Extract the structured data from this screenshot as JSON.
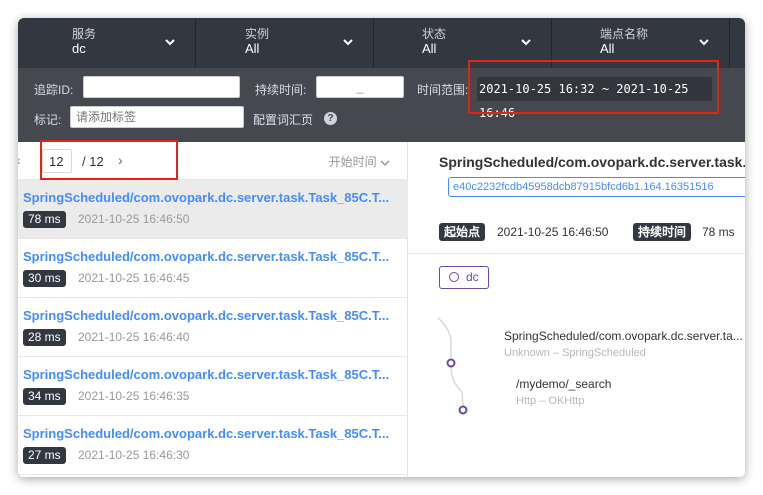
{
  "filters": [
    {
      "label": "服务",
      "value": "dc"
    },
    {
      "label": "实例",
      "value": "All"
    },
    {
      "label": "状态",
      "value": "All"
    },
    {
      "label": "端点名称",
      "value": "All"
    }
  ],
  "search": {
    "trace_id_label": "追踪ID:",
    "trace_id_value": "",
    "duration_label": "持续时间:",
    "duration_placeholder": "_",
    "time_range_label": "时间范围:",
    "time_range_value": "2021-10-25 16:32 ~ 2021-10-25 16:46",
    "tags_label": "标记:",
    "tags_placeholder": "请添加标签",
    "config_link": "配置词汇页",
    "help_symbol": "?"
  },
  "pager": {
    "prev_symbol": "‹",
    "current_page": "12",
    "total": "/ 12",
    "next_symbol": "›",
    "sort_label": "开始时间"
  },
  "traces": [
    {
      "name": "SpringScheduled/com.ovopark.dc.server.task.Task_85C.T...",
      "duration": "78 ms",
      "time": "2021-10-25 16:46:50"
    },
    {
      "name": "SpringScheduled/com.ovopark.dc.server.task.Task_85C.T...",
      "duration": "30 ms",
      "time": "2021-10-25 16:46:45"
    },
    {
      "name": "SpringScheduled/com.ovopark.dc.server.task.Task_85C.T...",
      "duration": "28 ms",
      "time": "2021-10-25 16:46:40"
    },
    {
      "name": "SpringScheduled/com.ovopark.dc.server.task.Task_85C.T...",
      "duration": "34 ms",
      "time": "2021-10-25 16:46:35"
    },
    {
      "name": "SpringScheduled/com.ovopark.dc.server.task.Task_85C.T...",
      "duration": "27 ms",
      "time": "2021-10-25 16:46:30"
    }
  ],
  "detail": {
    "title": "SpringScheduled/com.ovopark.dc.server.task.",
    "trace_id": "e40c2232fcdb45958dcb87915bfcd6b1.164.16351516",
    "start_label": "起始点",
    "start_value": "2021-10-25 16:46:50",
    "duration_label": "持续时间",
    "duration_value": "78 ms",
    "service_chip": "dc",
    "spans": [
      {
        "name": "SpringScheduled/com.ovopark.dc.server.ta...",
        "sub": "Unknown – SpringScheduled"
      },
      {
        "name": "/mydemo/_search",
        "sub": "Http – OKHttp"
      }
    ]
  },
  "colors": {
    "link_blue": "#448dfe",
    "highlight_red": "#e2231a",
    "span_purple": "#6b4aa8",
    "header_dark": "#333840"
  }
}
